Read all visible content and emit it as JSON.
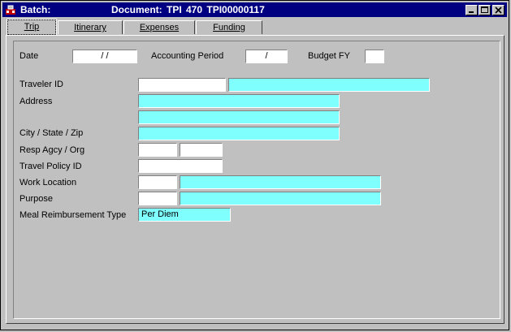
{
  "titlebar": {
    "batch": "Batch:",
    "document": "Document:  TPI   470   TPI00000117"
  },
  "tabs": [
    {
      "label": "Trip",
      "active": true
    },
    {
      "label": "Itinerary",
      "active": false
    },
    {
      "label": "Expenses",
      "active": false
    },
    {
      "label": "Funding",
      "active": false
    }
  ],
  "form": {
    "date_label": "Date",
    "date_value": "/     /",
    "accounting_period_label": "Accounting Period",
    "accounting_period_value": "/",
    "budget_fy_label": "Budget FY",
    "budget_fy_value": "",
    "traveler_id_label": "Traveler ID",
    "address_label": "Address",
    "city_state_zip_label": "City / State / Zip",
    "resp_agcy_org_label": "Resp Agcy / Org",
    "travel_policy_id_label": "Travel Policy ID",
    "work_location_label": "Work Location",
    "purpose_label": "Purpose",
    "meal_reimbursement_type_label": "Meal Reimbursement Type",
    "meal_reimbursement_type_value": "Per Diem"
  },
  "colors": {
    "titlebar": "#000080",
    "readonly_field": "#80ffff",
    "window": "#c0c0c0"
  }
}
